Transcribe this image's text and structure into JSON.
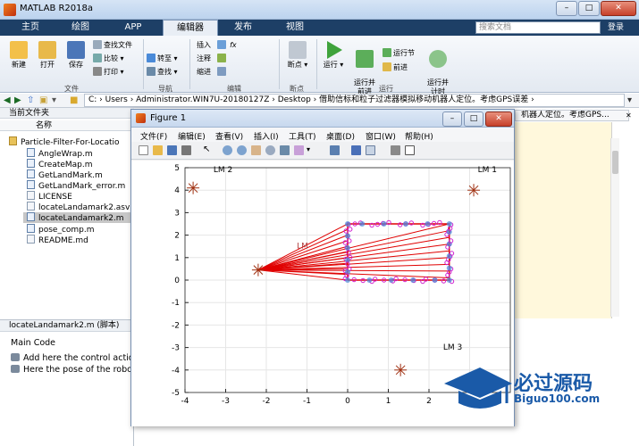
{
  "window": {
    "title": "MATLAB R2018a",
    "min": "–",
    "max": "□",
    "close": "✕"
  },
  "tabs": [
    {
      "label": "主页"
    },
    {
      "label": "绘图"
    },
    {
      "label": "APP"
    },
    {
      "label": "编辑器"
    },
    {
      "label": "发布"
    },
    {
      "label": "视图"
    }
  ],
  "search": {
    "placeholder": "搜索文档"
  },
  "login": "登录",
  "ribbon": {
    "new": "新建",
    "open": "打开",
    "save": "保存",
    "find_files": "查找文件",
    "compare": "比较",
    "print": "打印",
    "goto": "转至",
    "find": "查找",
    "insert": "插入",
    "comment": "注释",
    "indent": "缩进",
    "breakpoints": "断点",
    "run": "运行",
    "run_advance": "运行并\n前进",
    "run_section": "运行节",
    "advance": "前进",
    "run_time": "运行并\n计时",
    "groups": {
      "file": "文件",
      "nav": "导航",
      "edit": "编辑",
      "bp": "断点",
      "run": "运行"
    }
  },
  "address": {
    "path": "C: › Users › Administrator.WIN7U-20180127Z › Desktop › 借助信标和粒子过滤器模拟移动机器人定位。考虑GPS误差 ›"
  },
  "current_folder": {
    "header": "当前文件夹",
    "col_name": "名称",
    "root": "Particle-Filter-For-Locatio",
    "files": [
      "AngleWrap.m",
      "CreateMap.m",
      "GetLandMark.m",
      "GetLandMark_error.m",
      "LICENSE",
      "locateLandamark2.asv",
      "locateLandamark2.m",
      "pose_comp.m",
      "README.md"
    ]
  },
  "details": {
    "header": "locateLandamark2.m (脚本)",
    "section": "Main Code",
    "lines": [
      "Add here the control action",
      "Here the pose of the robot"
    ]
  },
  "editor_right": {
    "tab_text": "机器人定位。考虑GPS..."
  },
  "figure": {
    "title": "Figure 1",
    "menu": [
      "文件(F)",
      "编辑(E)",
      "查看(V)",
      "插入(I)",
      "工具(T)",
      "桌面(D)",
      "窗口(W)",
      "帮助(H)"
    ]
  },
  "chart_data": {
    "type": "scatter",
    "title": "",
    "xlabel": "",
    "ylabel": "",
    "xlim": [
      -4,
      4
    ],
    "ylim": [
      -5,
      5
    ],
    "xticks": [
      -4,
      -3,
      -2,
      -1,
      0,
      1,
      2,
      3
    ],
    "yticks": [
      -5,
      -4,
      -3,
      -2,
      -1,
      0,
      1,
      2,
      3,
      4,
      5
    ],
    "grid": true,
    "landmarks": [
      {
        "label": "LM 1",
        "x": 3.1,
        "y": 4.0
      },
      {
        "label": "LM 2",
        "x": -3.8,
        "y": 4.1
      },
      {
        "label": "LM 3",
        "x": 1.3,
        "y": -4.0
      },
      {
        "label": "",
        "x": -2.2,
        "y": 0.45
      }
    ],
    "label_positions_note": "",
    "robot_path": [
      [
        0,
        0
      ],
      [
        2.5,
        0
      ],
      [
        2.5,
        2.5
      ],
      [
        0,
        2.5
      ],
      [
        0,
        0
      ]
    ],
    "ray_origin": [
      -2.2,
      0.45
    ],
    "faint_label": "LM"
  },
  "watermark": {
    "cn": "必过源码",
    "url": "Biguo100.com"
  },
  "colors": {
    "ribbon_dark": "#1d3f66",
    "path_red": "#e00000",
    "particle_magenta": "#d020d0",
    "landmark": "#a03010"
  }
}
